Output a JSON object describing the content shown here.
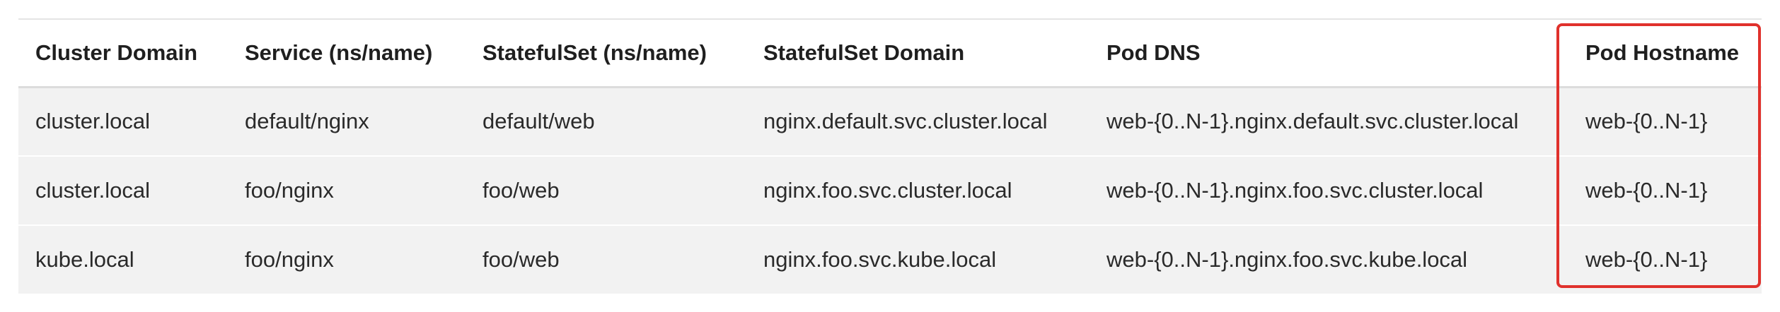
{
  "table": {
    "columns": [
      "Cluster Domain",
      "Service (ns/name)",
      "StatefulSet (ns/name)",
      "StatefulSet Domain",
      "Pod DNS",
      "Pod Hostname"
    ],
    "rows": [
      [
        "cluster.local",
        "default/nginx",
        "default/web",
        "nginx.default.svc.cluster.local",
        "web-{0..N-1}.nginx.default.svc.cluster.local",
        "web-{0..N-1}"
      ],
      [
        "cluster.local",
        "foo/nginx",
        "foo/web",
        "nginx.foo.svc.cluster.local",
        "web-{0..N-1}.nginx.foo.svc.cluster.local",
        "web-{0..N-1}"
      ],
      [
        "kube.local",
        "foo/nginx",
        "foo/web",
        "nginx.foo.svc.kube.local",
        "web-{0..N-1}.nginx.foo.svc.kube.local",
        "web-{0..N-1}"
      ]
    ]
  },
  "highlight": {
    "color": "#e0312c",
    "target_column": "Pod Hostname"
  }
}
